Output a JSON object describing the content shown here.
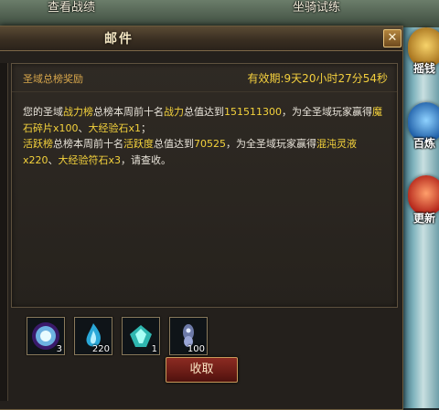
{
  "top_bar": {
    "left_label": "查看战绩",
    "right_label": "坐骑试练"
  },
  "side_buttons": [
    {
      "label": "摇钱"
    },
    {
      "label": "百炼"
    },
    {
      "label": "更新"
    }
  ],
  "mail": {
    "title": "邮件",
    "close_symbol": "✕",
    "subject": "圣域总榜奖励",
    "validity": "有效期:9天20小时27分54秒",
    "body": {
      "p1_a": "您的圣域",
      "p1_rank": "战力榜",
      "p1_b": "总榜本周前十名",
      "p1_stat": "战力",
      "p1_c": "总值达到",
      "p1_value": "151511300",
      "p1_d": "，为全圣域玩家赢得",
      "p1_item1": "魔石碎片x100",
      "p1_sep": "、",
      "p1_item2": "大经验石x1",
      "p1_end": "；",
      "p2_rank": "活跃榜",
      "p2_b": "总榜本周前十名",
      "p2_stat": "活跃度",
      "p2_c": "总值达到",
      "p2_value": "70525",
      "p2_d": "，为全圣域玩家赢得",
      "p2_item1": "混沌灵液x220",
      "p2_sep": "、",
      "p2_item2": "大经验符石x3",
      "p2_end": "，请查收。"
    },
    "rewards": [
      {
        "icon": "glowing-gem-icon",
        "qty": "3"
      },
      {
        "icon": "blue-flame-icon",
        "qty": "220"
      },
      {
        "icon": "crystal-shard-icon",
        "qty": "1"
      },
      {
        "icon": "magic-stone-icon",
        "qty": "100"
      }
    ],
    "claim_label": "收取"
  },
  "colors": {
    "accent": "#f4d23c",
    "subject": "#d8a74c",
    "body_text": "#e9e4da",
    "button": "#7a231c"
  }
}
